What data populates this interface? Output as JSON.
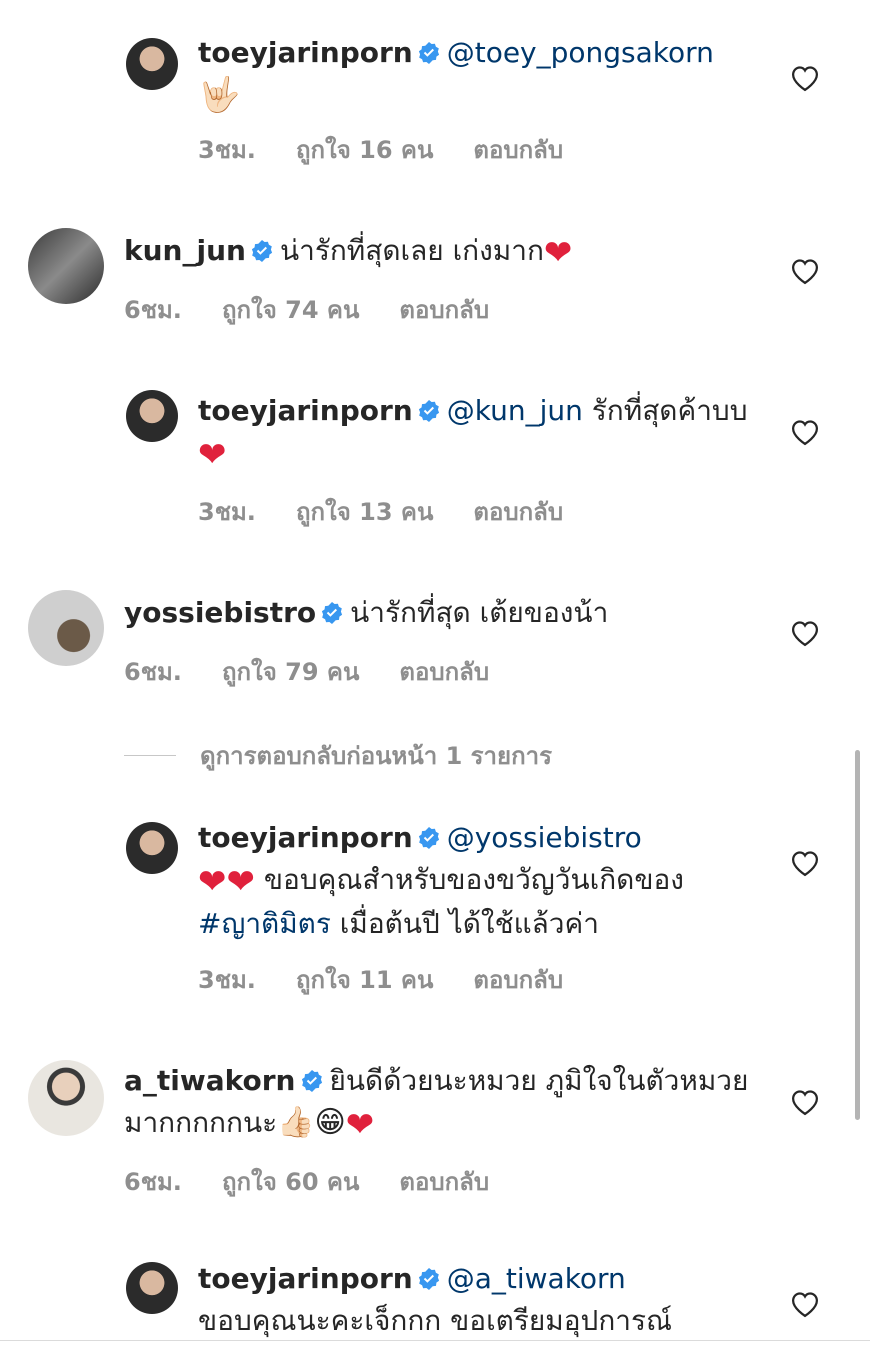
{
  "comments": [
    {
      "user": "toeyjarinporn",
      "mention": "@toey_pongsakorn",
      "text": " ",
      "emoji": "🤟🏻",
      "time": "3ชม.",
      "likes": "ถูกใจ 16 คน",
      "reply": "ตอบกลับ"
    },
    {
      "user": "kun_jun",
      "mention": "",
      "text": "น่ารักที่สุดเลย เก่งมาก",
      "emoji": "❤",
      "time": "6ชม.",
      "likes": "ถูกใจ 74 คน",
      "reply": "ตอบกลับ"
    },
    {
      "user": "toeyjarinporn",
      "mention": "@kun_jun",
      "text": " รักที่สุดค้าบบ ",
      "emoji": "❤",
      "time": "3ชม.",
      "likes": "ถูกใจ 13 คน",
      "reply": "ตอบกลับ"
    },
    {
      "user": "yossiebistro",
      "mention": "",
      "text": "น่ารักที่สุด เต้ยของน้า",
      "emoji": "",
      "time": "6ชม.",
      "likes": "ถูกใจ 79 คน",
      "reply": "ตอบกลับ"
    },
    {
      "user": "toeyjarinporn",
      "mention": "@yossiebistro",
      "text_before": "❤❤",
      "text": " ขอบคุณสำหรับของขวัญวันเกิดของ ",
      "hashtag": "#ญาติมิตร",
      "text_after": " เมื่อต้นปี ได้ใช้แล้วค่า",
      "time": "3ชม.",
      "likes": "ถูกใจ 11 คน",
      "reply": "ตอบกลับ"
    },
    {
      "user": "a_tiwakorn",
      "mention": "",
      "text": "ยินดีด้วยนะหมวย ภูมิใจในตัวหมวยมากกกกกนะ",
      "emoji": "👍🏻😁",
      "emoji2": "❤",
      "time": "6ชม.",
      "likes": "ถูกใจ 60 คน",
      "reply": "ตอบกลับ"
    },
    {
      "user": "toeyjarinporn",
      "mention": "@a_tiwakorn",
      "text": "ขอบคุณนะคะเจ็กกก ขอเตรียมอุปการณ์"
    }
  ],
  "view_previous": "ดูการตอบกลับก่อนหน้า 1 รายการ",
  "colors": {
    "mention": "#00376b",
    "meta": "#8e8e8e",
    "heart_red": "#e0213c",
    "verified": "#3897f0"
  }
}
